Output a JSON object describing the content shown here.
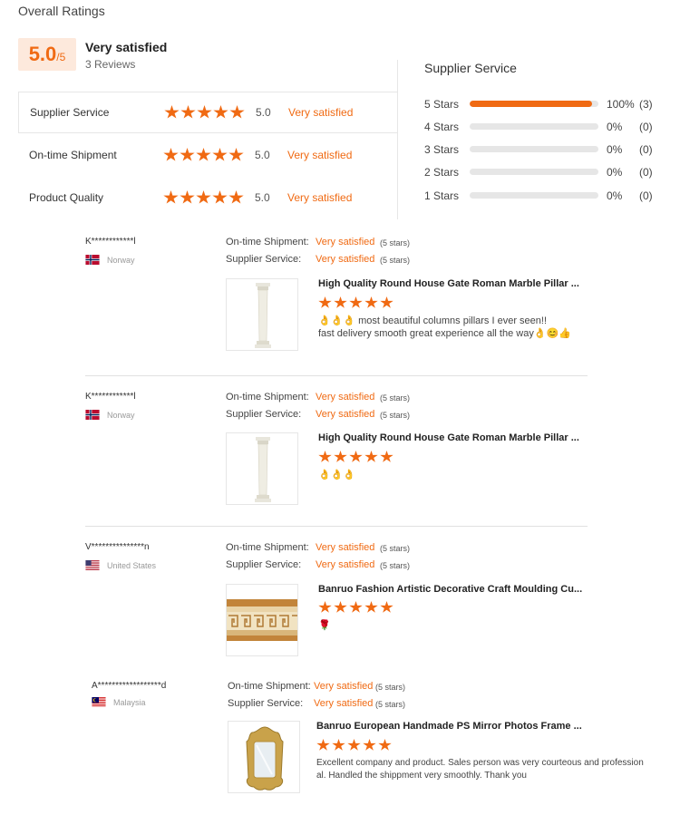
{
  "header": {
    "title": "Overall Ratings",
    "score": "5.0",
    "score_max": "/5",
    "summary": "Very satisfied",
    "review_count": "3 Reviews"
  },
  "categories": [
    {
      "label": "Supplier Service",
      "score": "5.0",
      "text": "Very satisfied",
      "stars": 5
    },
    {
      "label": "On-time Shipment",
      "score": "5.0",
      "text": "Very satisfied",
      "stars": 5
    },
    {
      "label": "Product Quality",
      "score": "5.0",
      "text": "Very satisfied",
      "stars": 5
    }
  ],
  "distribution": {
    "title": "Supplier Service",
    "rows": [
      {
        "label": "5 Stars",
        "pct": "100%",
        "count": "(3)",
        "fill": 0.95
      },
      {
        "label": "4 Stars",
        "pct": "0%",
        "count": "(0)",
        "fill": 0
      },
      {
        "label": "3 Stars",
        "pct": "0%",
        "count": "(0)",
        "fill": 0
      },
      {
        "label": "2 Stars",
        "pct": "0%",
        "count": "(0)",
        "fill": 0
      },
      {
        "label": "1 Stars",
        "pct": "0%",
        "count": "(0)",
        "fill": 0
      }
    ]
  },
  "reviews": [
    {
      "user": "K************l",
      "country": "Norway",
      "shipment_label": "On-time Shipment:",
      "shipment_value": "Very satisfied",
      "shipment_stars": "(5 stars)",
      "service_label": "Supplier Service:",
      "service_value": "Very satisfied",
      "service_stars": "(5 stars)",
      "product": "High Quality Round House Gate Roman Marble Pillar ...",
      "rating": 5,
      "text_line1": "👌👌👌 most beautiful columns pillars I ever seen!!",
      "text_line2": "fast delivery smooth great experience all the way👌😊👍"
    },
    {
      "user": "K************l",
      "country": "Norway",
      "shipment_label": "On-time Shipment:",
      "shipment_value": "Very satisfied",
      "shipment_stars": "(5 stars)",
      "service_label": "Supplier Service:",
      "service_value": "Very satisfied",
      "service_stars": "(5 stars)",
      "product": "High Quality Round House Gate Roman Marble Pillar ...",
      "rating": 5,
      "text_line1": "👌👌👌",
      "text_line2": ""
    },
    {
      "user": "V***************n",
      "country": "United States",
      "shipment_label": "On-time Shipment:",
      "shipment_value": "Very satisfied",
      "shipment_stars": "(5 stars)",
      "service_label": "Supplier Service:",
      "service_value": "Very satisfied",
      "service_stars": "(5 stars)",
      "product": "Banruo Fashion Artistic Decorative Craft Moulding Cu...",
      "rating": 5,
      "text_line1": "🌹",
      "text_line2": ""
    },
    {
      "user": "A******************d",
      "country": "Malaysia",
      "shipment_label": "On-time Shipment:",
      "shipment_value": "Very satisfied",
      "shipment_stars": "(5 stars)",
      "service_label": "Supplier Service:",
      "service_value": "Very satisfied",
      "service_stars": "(5 stars)",
      "product": "Banruo European Handmade PS Mirror Photos Frame ...",
      "rating": 5,
      "text_line1": "Excellent company and product. Sales person was very courteous and profession",
      "text_line2": "al. Handled the shippment very smoothly. Thank you"
    }
  ],
  "colors": {
    "accent": "#f06a13",
    "score_bg": "#fde9dc",
    "bar_bg": "#e6e6e6"
  }
}
